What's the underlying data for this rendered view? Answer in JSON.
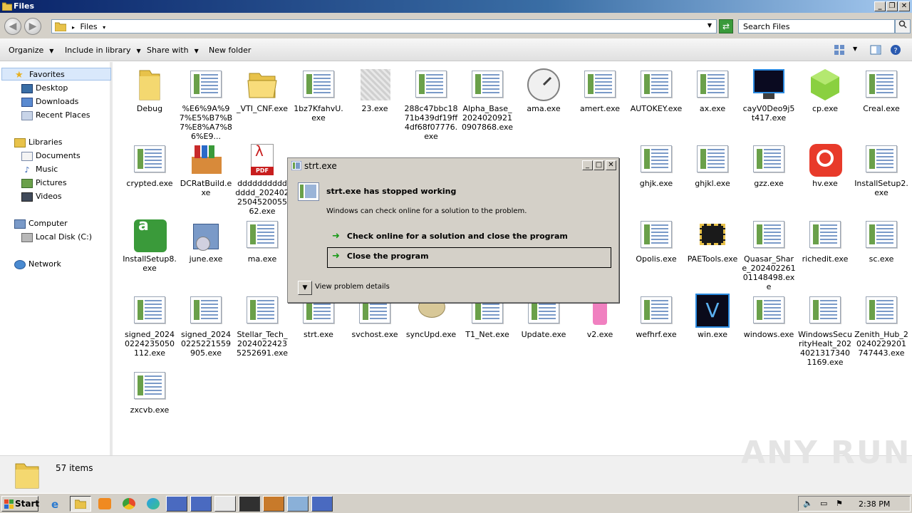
{
  "window": {
    "title": "Files"
  },
  "address": {
    "crumbs": [
      "Files"
    ],
    "search_placeholder": "Search Files"
  },
  "toolbar": {
    "organize": "Organize",
    "include_library": "Include in library",
    "share_with": "Share with",
    "new_folder": "New folder"
  },
  "sidebar": {
    "favorites": {
      "label": "Favorites",
      "items": [
        "Desktop",
        "Downloads",
        "Recent Places"
      ]
    },
    "libraries": {
      "label": "Libraries",
      "items": [
        "Documents",
        "Music",
        "Pictures",
        "Videos"
      ]
    },
    "computer": {
      "label": "Computer",
      "items": [
        "Local Disk (C:)"
      ]
    },
    "network": {
      "label": "Network"
    }
  },
  "files": [
    "Debug",
    "%E6%9A%97%E5%B7%B7%E8%A7%86%E9...",
    "_VTI_CNF.exe",
    "1bz7KfahvU.exe",
    "23.exe",
    "288c47bbc1871b439df19ff4df68f07776.exe",
    "Alpha_Base_20240209210907868.exe",
    "ama.exe",
    "amert.exe",
    "AUTOKEY.exe",
    "ax.exe",
    "cayV0Deo9j5t417.exe",
    "cp.exe",
    "Creal.exe",
    "crypted.exe",
    "DCRatBuild.exe",
    "dddddddddddddd_202402250452005562.exe",
    "ghjk.exe",
    "ghjkl.exe",
    "gzz.exe",
    "hv.exe",
    "InstallSetup2.exe",
    "InstallSetup8.exe",
    "june.exe",
    "ma.exe",
    "Opolis.exe",
    "PAETools.exe",
    "Quasar_Share_20240226101148498.exe",
    "richedit.exe",
    "sc.exe",
    "signed_20240224235050112.exe",
    "signed_20240225221559905.exe",
    "Stellar_Tech_2024022423 5252691.exe",
    "strt.exe",
    "svchost.exe",
    "syncUpd.exe",
    "T1_Net.exe",
    "Update.exe",
    "v2.exe",
    "wefhrf.exe",
    "win.exe",
    "windows.exe",
    "WindowsSecurityHealt_20240213173401169.exe",
    "Zenith_Hub_20240229201747443.exe",
    "zxcvb.exe"
  ],
  "status": {
    "count": "57 items"
  },
  "taskbar": {
    "start": "Start",
    "clock": "2:38 PM"
  },
  "dialog": {
    "title": "strt.exe",
    "heading": "strt.exe has stopped working",
    "message": "Windows can check online for a solution to the problem.",
    "option1": "Check online for a solution and close the program",
    "option2": "Close the program",
    "details": "View problem details"
  },
  "watermark": "ANY RUN"
}
